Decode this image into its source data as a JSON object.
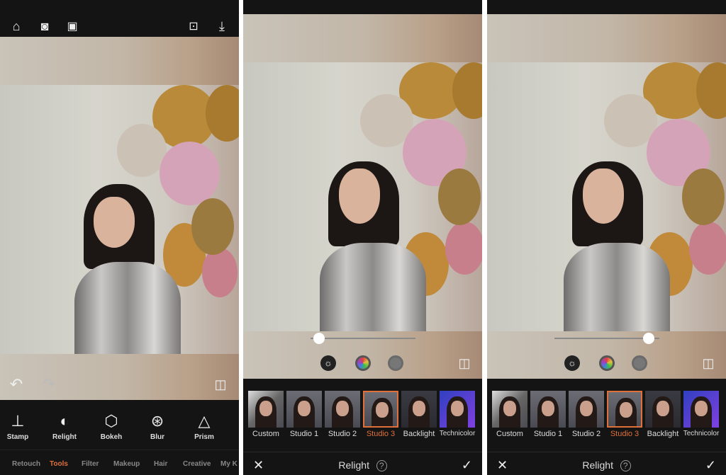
{
  "colors": {
    "accent": "#e0703a",
    "background": "#141414"
  },
  "editor": {
    "top_icons": [
      "home-icon",
      "camera-icon",
      "gallery-icon",
      "search-image-icon",
      "download-icon"
    ],
    "tools": [
      {
        "label": "Stamp",
        "icon": "stamp-icon"
      },
      {
        "label": "Relight",
        "icon": "relight-icon"
      },
      {
        "label": "Bokeh",
        "icon": "bokeh-icon"
      },
      {
        "label": "Blur",
        "icon": "aperture-icon"
      },
      {
        "label": "Prism",
        "icon": "prism-icon"
      }
    ],
    "tabs": [
      {
        "label": "Retouch"
      },
      {
        "label": "Tools",
        "active": true
      },
      {
        "label": "Filter"
      },
      {
        "label": "Makeup"
      },
      {
        "label": "Hair"
      },
      {
        "label": "Creative"
      },
      {
        "label": "My K"
      }
    ]
  },
  "relight_a": {
    "intensity": 0.08
  },
  "relight_b": {
    "intensity": 0.9
  },
  "relight": {
    "title": "Relight",
    "presets": [
      {
        "label": "Custom"
      },
      {
        "label": "Studio 1"
      },
      {
        "label": "Studio 2"
      },
      {
        "label": "Studio 3",
        "selected": true
      },
      {
        "label": "Backlight"
      },
      {
        "label": "Technicolor"
      }
    ],
    "modes": [
      "brightness-icon",
      "color-icon",
      "texture-icon"
    ]
  }
}
